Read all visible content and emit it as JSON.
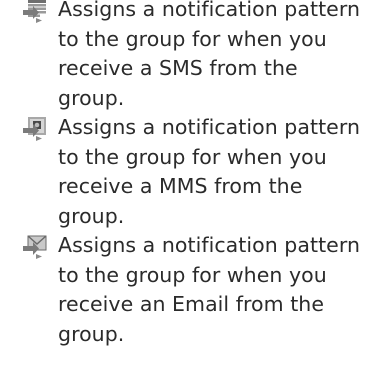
{
  "entries": [
    {
      "icon": "sms-notification-icon",
      "text": "Assigns a notification pattern to the group for when you receive a SMS from the group."
    },
    {
      "icon": "mms-notification-icon",
      "text": "Assigns a notification pattern to the group for when you receive a MMS from the group."
    },
    {
      "icon": "email-notification-icon",
      "text": "Assigns a notification pattern to the group for when you receive an Email from the group."
    }
  ]
}
